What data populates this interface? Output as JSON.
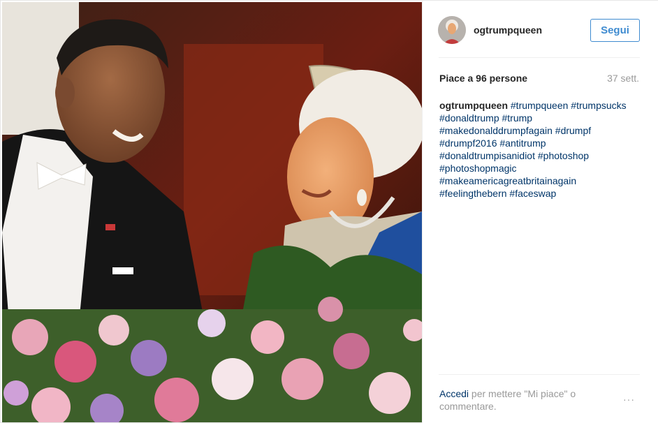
{
  "post": {
    "username": "ogtrumpqueen",
    "follow_label": "Segui",
    "likes_text": "Piace a 96 persone",
    "time_ago": "37 sett.",
    "caption": {
      "author": "ogtrumpqueen",
      "first_line_tags": "#trumpqueen #trumpsucks",
      "lines": [
        "#donaldtrump #trump",
        "#makedonalddrumpfagain #drumpf",
        "#drumpf2016 #antitrump",
        "#donaldtrumpisanidiot #photoshop",
        "#photoshopmagic",
        "#makeamericagreatbritainagain",
        "#feelingthebern #faceswap"
      ]
    },
    "footer": {
      "login_link": "Accedi",
      "text": " per mettere \"Mi piace\" o commentare.",
      "more_icon": "···"
    }
  },
  "colors": {
    "link": "#003569",
    "follow": "#3f8bd0",
    "muted": "#999999",
    "text": "#262626"
  },
  "icons": [
    "avatar",
    "more-options-icon"
  ]
}
